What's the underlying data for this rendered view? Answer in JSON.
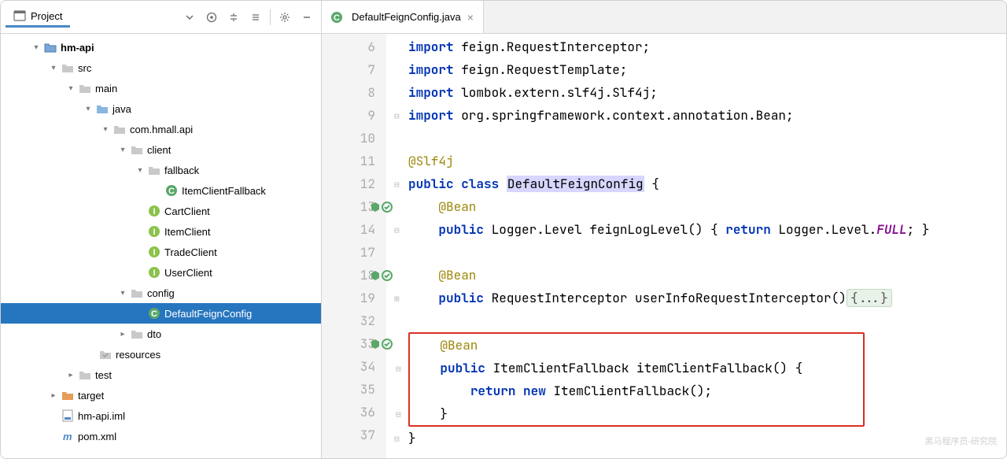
{
  "sidebar": {
    "title": "Project"
  },
  "tree": {
    "root": "hm-api",
    "src": "src",
    "main": "main",
    "java": "java",
    "pkg": "com.hmall.api",
    "client": "client",
    "fallback": "fallback",
    "itemClientFallback": "ItemClientFallback",
    "cartClient": "CartClient",
    "itemClient": "ItemClient",
    "tradeClient": "TradeClient",
    "userClient": "UserClient",
    "config": "config",
    "defaultFeignConfig": "DefaultFeignConfig",
    "dto": "dto",
    "resources": "resources",
    "test": "test",
    "target": "target",
    "iml": "hm-api.iml",
    "pom": "pom.xml"
  },
  "tab": {
    "file": "DefaultFeignConfig.java"
  },
  "gutter": [
    "6",
    "7",
    "8",
    "9",
    "10",
    "11",
    "12",
    "13",
    "14",
    "17",
    "18",
    "19",
    "32",
    "33",
    "34",
    "35",
    "36",
    "37"
  ],
  "code": {
    "l6": {
      "kw": "import",
      "rest": " feign.RequestInterceptor;"
    },
    "l7": {
      "kw": "import",
      "rest": " feign.RequestTemplate;"
    },
    "l8": {
      "kw": "import",
      "rest": " lombok.extern.slf4j.",
      "cls": "Slf4j",
      "end": ";"
    },
    "l9": {
      "kw": "import",
      "rest": " org.springframework.context.annotation.",
      "cls": "Bean",
      "end": ";"
    },
    "l11": {
      "ann": "@Slf4j"
    },
    "l12": {
      "kw1": "public",
      "kw2": "class",
      "name": "DefaultFeignConfig",
      "brace": " {"
    },
    "l13": {
      "ann": "@Bean"
    },
    "l14": {
      "kw": "public",
      "ret": " Logger.Level feignLogLevel() { ",
      "kw2": "return",
      "rest": " Logger.Level.",
      "stat": "FULL",
      "end": "; }"
    },
    "l18": {
      "ann": "@Bean"
    },
    "l19": {
      "kw": "public",
      "rest": " RequestInterceptor userInfoRequestInterceptor()",
      "fold": "{...}"
    },
    "l33": {
      "ann": "@Bean"
    },
    "l34": {
      "kw": "public",
      "rest": " ItemClientFallback itemClientFallback() {"
    },
    "l35": {
      "kw1": "return",
      "kw2": "new",
      "rest": " ItemClientFallback();"
    },
    "l36": {
      "brace": "}"
    },
    "l37": {
      "brace": "}"
    }
  },
  "watermark": "黑马程序员-研究院"
}
